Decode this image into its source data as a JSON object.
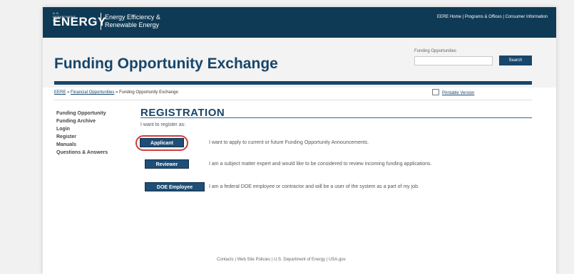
{
  "banner": {
    "logo_small": "U.S. DEPARTMENT OF",
    "logo_energy": "ENERGY",
    "logo_line1": "Energy Efficiency &",
    "logo_line2": "Renewable Energy",
    "links": "EERE Home | Programs & Offices | Consumer Information"
  },
  "header": {
    "title": "Funding Opportunity Exchange",
    "search_label": "Funding Opportunities",
    "search_value": "",
    "search_button": "Search"
  },
  "breadcrumb": {
    "item1": "EERE",
    "sep1": " » ",
    "item2": "Financial Opportunities",
    "sep2": " » ",
    "current": "Funding Opportunity Exchange",
    "printable": "Printable Version"
  },
  "sidebar": {
    "items": [
      {
        "label": "Funding Opportunity"
      },
      {
        "label": "Funding Archive"
      },
      {
        "label": "Login"
      },
      {
        "label": "Register"
      },
      {
        "label": "Manuals"
      },
      {
        "label": "Questions & Answers"
      }
    ]
  },
  "main": {
    "title": "REGISTRATION",
    "intro": "I want to register as:",
    "options": [
      {
        "button": "Applicant",
        "description": "I want to apply to current or future Funding Opportunity Announcements."
      },
      {
        "button": "Reviewer",
        "description": "I am a subject matter expert and would like to be considered to review incoming funding applications."
      },
      {
        "button": "DOE Employee",
        "description": "I am a federal DOE employee or contractor and will be a user of the system as a part of my job."
      }
    ]
  },
  "footer": {
    "text": "Contacts | Web Site Policies | U.S. Department of Energy | USA.gov"
  },
  "colors": {
    "banner": "#0f3a55",
    "accent": "#17466b",
    "highlight": "#d23b3b"
  }
}
